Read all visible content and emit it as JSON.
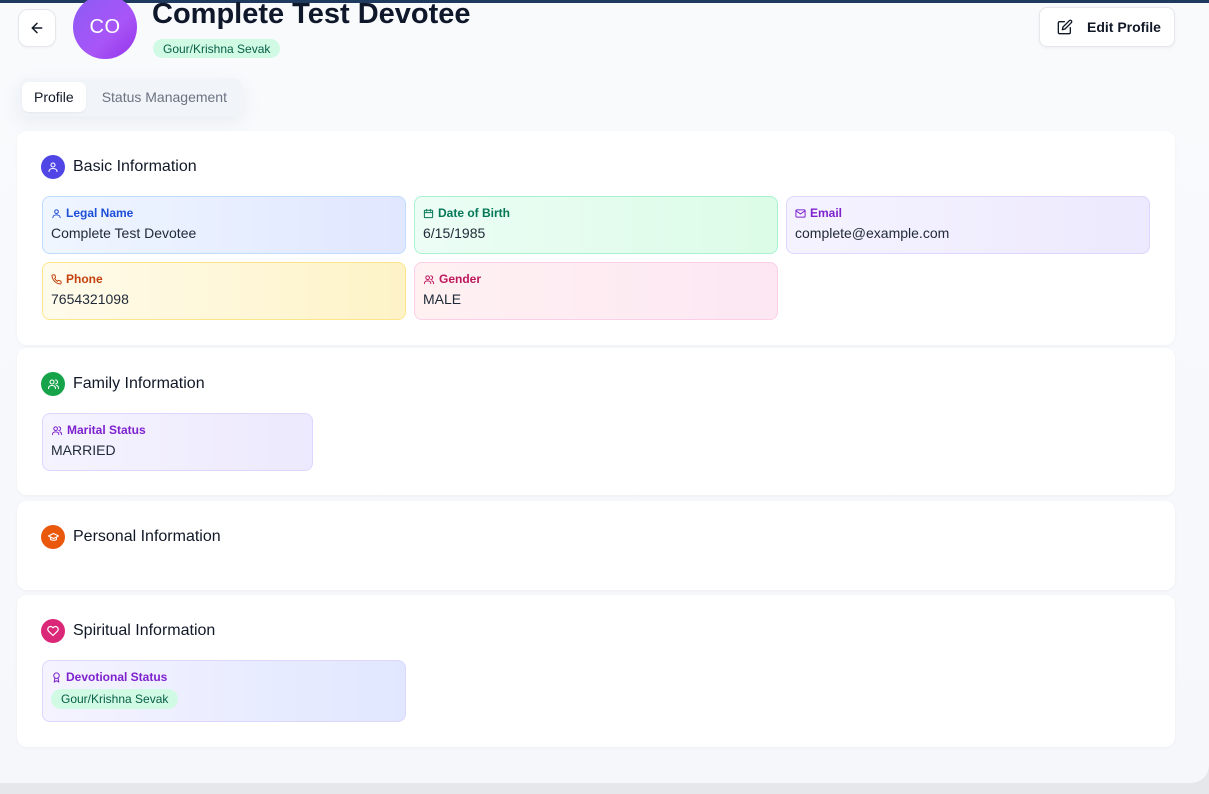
{
  "header": {
    "avatar_initials": "CO",
    "title": "Complete Test Devotee",
    "badge": "Gour/Krishna Sevak",
    "edit_label": "Edit Profile"
  },
  "tabs": [
    {
      "label": "Profile",
      "active": true
    },
    {
      "label": "Status Management",
      "active": false
    }
  ],
  "sections": {
    "basic": {
      "title": "Basic Information",
      "icon": "user-icon",
      "fields": [
        {
          "label": "Legal Name",
          "value": "Complete Test Devotee",
          "icon": "user-icon",
          "color": "blue"
        },
        {
          "label": "Date of Birth",
          "value": "6/15/1985",
          "icon": "calendar-icon",
          "color": "green"
        },
        {
          "label": "Email",
          "value": "complete@example.com",
          "icon": "mail-icon",
          "color": "purple"
        },
        {
          "label": "Phone",
          "value": "7654321098",
          "icon": "phone-icon",
          "color": "amber"
        },
        {
          "label": "Gender",
          "value": "MALE",
          "icon": "users-icon",
          "color": "pink"
        }
      ]
    },
    "family": {
      "title": "Family Information",
      "icon": "users-icon",
      "fields": [
        {
          "label": "Marital Status",
          "value": "MARRIED",
          "icon": "users-icon",
          "color": "purple"
        }
      ]
    },
    "personal": {
      "title": "Personal Information",
      "icon": "graduation-cap-icon"
    },
    "spiritual": {
      "title": "Spiritual Information",
      "icon": "heart-icon",
      "fields": [
        {
          "label": "Devotional Status",
          "badge": "Gour/Krishna Sevak",
          "icon": "award-icon",
          "color": "violet"
        }
      ]
    }
  },
  "colors": {
    "basic_icon_bg": "#4f46e5",
    "family_icon_bg": "#16a34a",
    "personal_icon_bg": "#ea580c",
    "spiritual_icon_bg": "#db2777",
    "badge_bg": "#d1fae5",
    "badge_text": "#065f46"
  }
}
